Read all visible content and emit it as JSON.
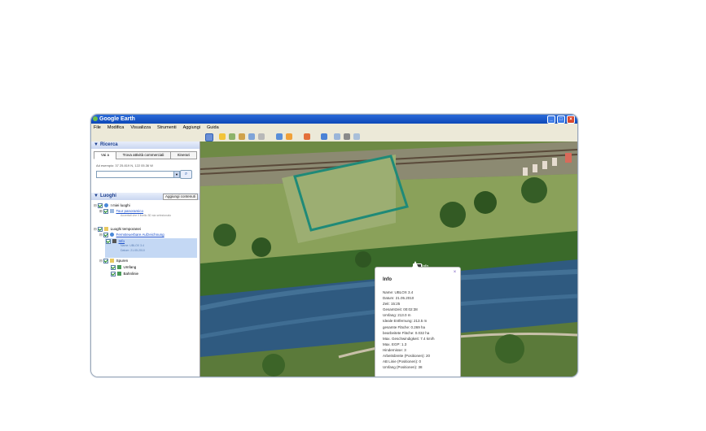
{
  "window": {
    "title": "Google Earth",
    "controls": {
      "minimize": "_",
      "maximize": "□",
      "close": "×"
    }
  },
  "menubar": [
    "File",
    "Modifica",
    "Visualizza",
    "Strumenti",
    "Aggiungi",
    "Guida"
  ],
  "search": {
    "header": "Ricerca",
    "tabs": [
      "Vai a",
      "Trova attività commerciali",
      "Itinerari"
    ],
    "hint": "Ad esempio: 37 25.819 N, 122 05.36 W",
    "input_value": "",
    "search_icon": "magnifier-icon"
  },
  "places": {
    "header": "Luoghi",
    "add_content_label": "Aggiungi contenuti",
    "tree": [
      {
        "label": "I miei luoghi",
        "checked": true,
        "icon": "globe-icon"
      },
      {
        "label": "Tour panoramico",
        "link": true,
        "checked": true,
        "icon": "tour-icon"
      },
      {
        "label": "Accertati che il livello 3D sia selezionato",
        "sub": true
      },
      {
        "label": "Luoghi temporanei",
        "checked": true,
        "icon": "folder-icon"
      },
      {
        "label": "Fernsteuerbare Aufzeichnung",
        "link": true,
        "checked": true,
        "icon": "globe-icon"
      },
      {
        "label": "Info",
        "link": true,
        "checked": true,
        "icon": "camera-icon",
        "selected": true
      },
      {
        "label": "Name: UBLOX 3.4",
        "sub": true
      },
      {
        "label": "Datum: 21.05.2010",
        "sub": true
      },
      {
        "label": "Spuren",
        "checked": true,
        "icon": "folder-icon"
      },
      {
        "label": "Umfang",
        "checked": true,
        "icon": "path-icon"
      },
      {
        "label": "Bahnlinie",
        "checked": true,
        "icon": "path-icon"
      }
    ]
  },
  "map": {
    "marker_label": "Info",
    "boundary_color": "#1f8a78",
    "river_color": "#2f5a80"
  },
  "popup": {
    "title": "Info",
    "lines": [
      "Name: UBLOX 3.4",
      "Datum: 21.05.2010",
      "Zeit: 15:25",
      "Gesamtzeit: 00:02:38",
      "Umfang: 213.0 m",
      "Ideale Entfernung: 213.5 m",
      "gesamte Fläche: 0.269 ha",
      "bearbeitete Fläche: 0.032 ha",
      "Max. Geschwindigkeit: 7.4 km/h",
      "Max. EGP: 1.3",
      "Hindernisse: 3",
      "Arbeitsbreite (Positionen): 20",
      "AB Linie (Positionen): 0",
      "Umfang (Positionen): 38"
    ],
    "close_icon": "close-icon"
  }
}
